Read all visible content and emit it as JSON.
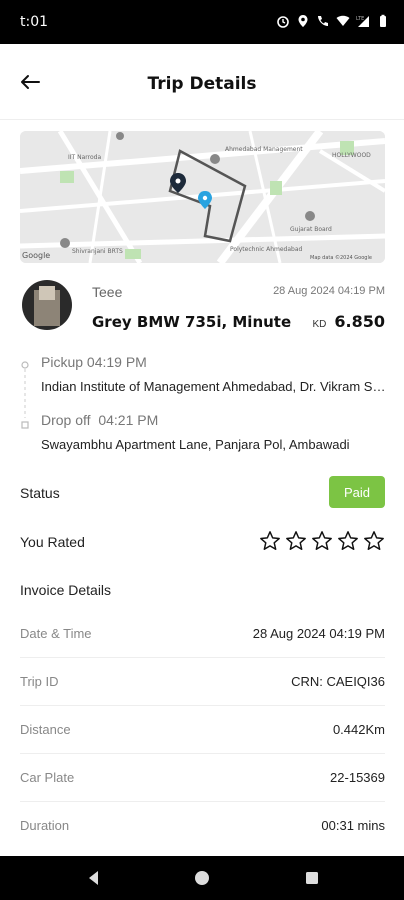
{
  "status_bar": {
    "time": "t:01",
    "icons": [
      "alarm-icon",
      "location-icon",
      "call-wifi-icon",
      "wifi-icon",
      "lte-signal-icon",
      "battery-icon"
    ],
    "lte_text": "LTE"
  },
  "header": {
    "title": "Trip Details",
    "back_icon": "arrow-left-icon"
  },
  "map": {
    "labels": [
      "Ahmedabad Management",
      "IIT Narroda",
      "HOLLYWOOD",
      "Shivranjani BRTS",
      "Google",
      "Map data ©2024 Google",
      "Gujarat Board",
      "Polytechnic Ahmedabad"
    ]
  },
  "trip": {
    "driver_name": "Teee",
    "date_time": "28 Aug 2024 04:19 PM",
    "car": "Grey BMW 735i, Minute",
    "currency": "KD",
    "amount": "6.850"
  },
  "route": {
    "pickup_label": "Pickup",
    "pickup_time": "04:19 PM",
    "pickup_address": "Indian Institute of Management Ahmedabad, Dr. Vikram Sarabhai Marg",
    "dropoff_label": "Drop off",
    "dropoff_time": "04:21 PM",
    "dropoff_address": "Swayambhu Apartment Lane, Panjara Pol, Ambawadi"
  },
  "status": {
    "label": "Status",
    "value": "Paid",
    "color": "#7cc444"
  },
  "rating": {
    "label": "You Rated",
    "stars": 5,
    "filled": 0
  },
  "invoice": {
    "title": "Invoice Details",
    "rows": [
      {
        "key": "Date & Time",
        "value": "28 Aug 2024 04:19 PM"
      },
      {
        "key": "Trip ID",
        "value": "CRN: CAEIQI36"
      },
      {
        "key": "Distance",
        "value": "0.442Km"
      },
      {
        "key": "Car Plate",
        "value": "22-15369"
      },
      {
        "key": "Duration",
        "value": "00:31 mins"
      }
    ]
  },
  "nav_bar": {
    "buttons": [
      "back-triangle-icon",
      "home-circle-icon",
      "recents-square-icon"
    ]
  }
}
